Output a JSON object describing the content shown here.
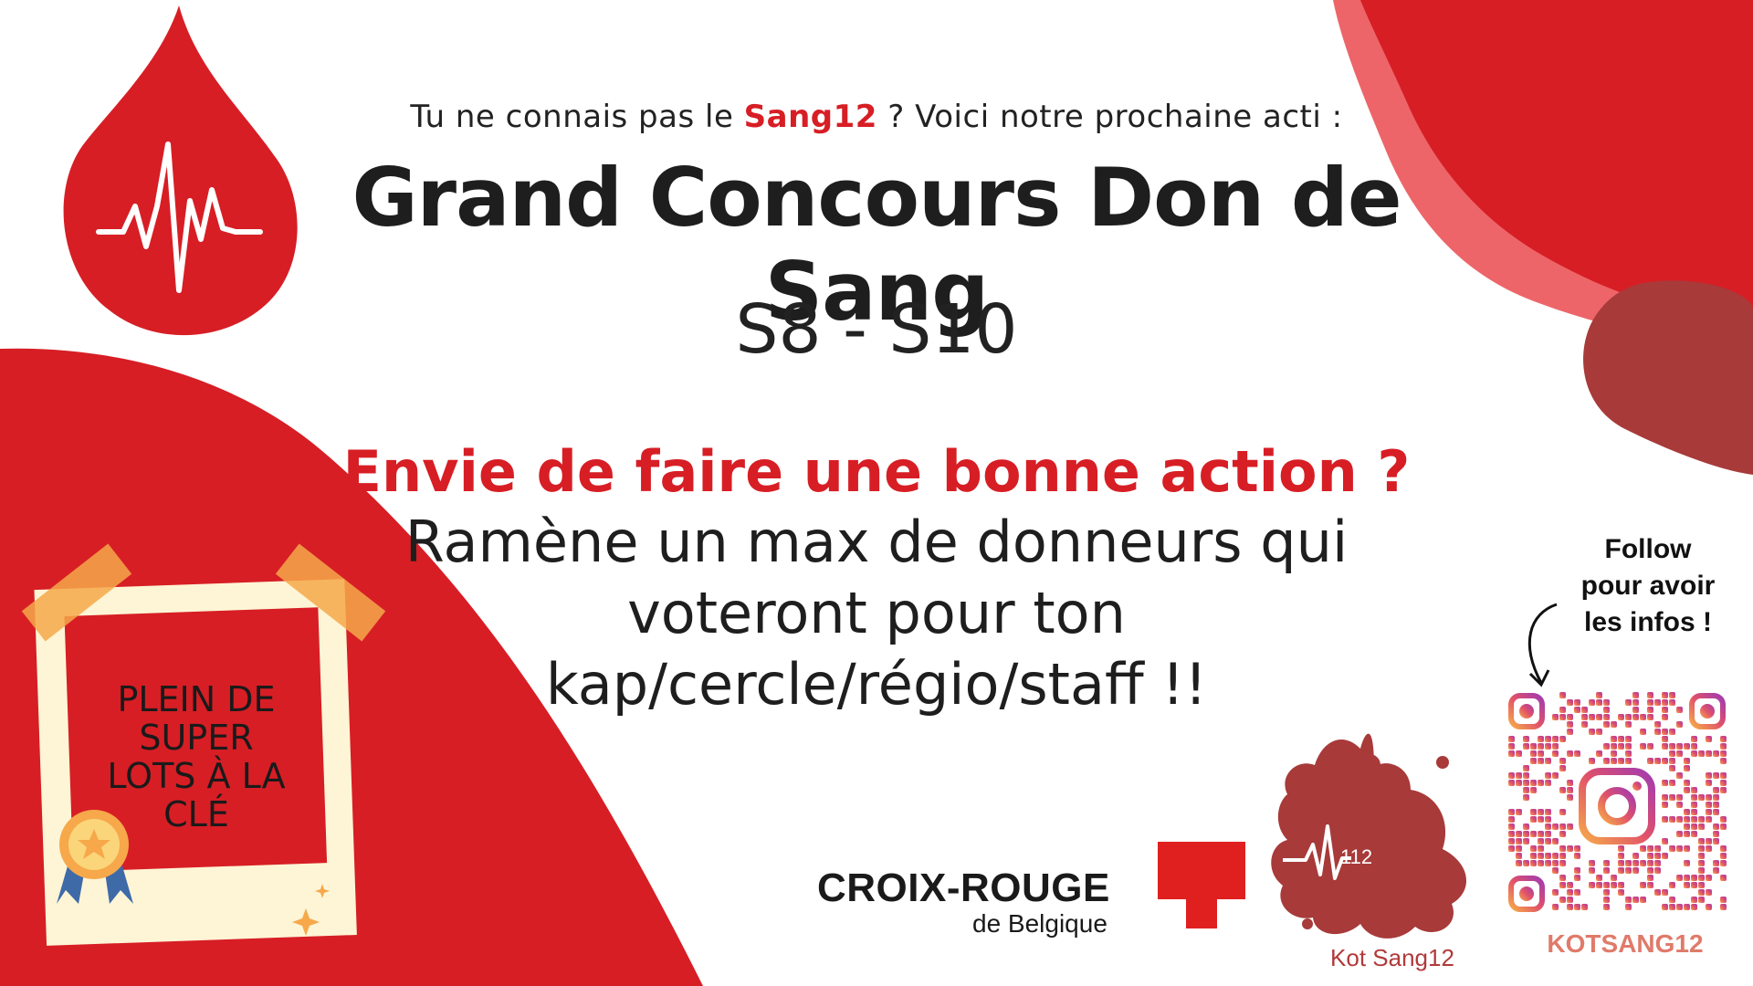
{
  "header": {
    "intro_prefix": "Tu ne connais pas le ",
    "intro_highlight": "Sang12",
    "intro_suffix": " ? Voici notre prochaine acti :",
    "title": "Grand Concours Don de Sang",
    "weeks": "S8 - S10"
  },
  "message": {
    "cta": "Envie de faire une bonne action ?",
    "line1": "Ramène un max de donneurs qui",
    "line2": "voteront pour ton",
    "line3": "kap/cercle/régio/staff !!"
  },
  "prize": {
    "line1": "PLEIN DE",
    "line2": "SUPER",
    "line3": "LOTS À LA",
    "line4": "CLÉ"
  },
  "social": {
    "follow_line1": "Follow",
    "follow_line2": "pour avoir",
    "follow_line3": "les infos !",
    "qr_caption": "KOTSANG12"
  },
  "logos": {
    "croix_rouge_name": "CROIX-ROUGE",
    "croix_rouge_sub": "de Belgique",
    "kot_number": "112",
    "kot_label": "Kot Sang12"
  },
  "icons": {
    "blood_drop": "blood-drop-icon",
    "heartbeat": "heartbeat-icon",
    "medal": "medal-icon",
    "arrow": "curved-arrow-icon",
    "instagram": "instagram-icon",
    "red_cross": "red-cross-icon"
  },
  "colors": {
    "primary_red": "#d71e25",
    "dark_red": "#a83a3a",
    "paper": "#fdf5d6",
    "tape": "#f6a84a",
    "text": "#1e1e1e"
  }
}
